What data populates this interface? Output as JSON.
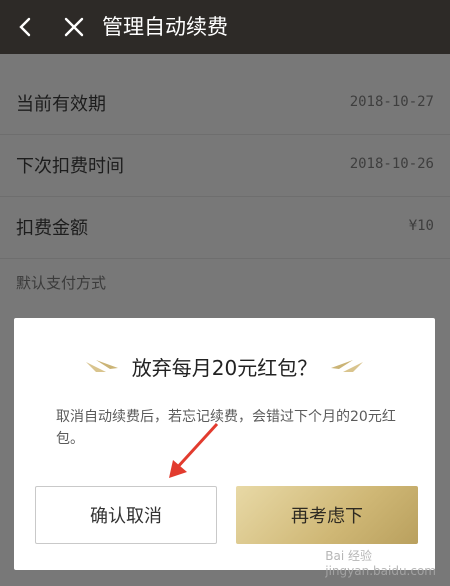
{
  "header": {
    "title": "管理自动续费",
    "back_icon": "chevron-left-icon",
    "close_icon": "close-icon"
  },
  "rows": [
    {
      "label": "当前有效期",
      "value": "2018-10-27"
    },
    {
      "label": "下次扣费时间",
      "value": "2018-10-26"
    },
    {
      "label": "扣费金额",
      "value": "¥10"
    }
  ],
  "section": {
    "payment_label": "默认支付方式"
  },
  "dialog": {
    "title": "放弃每月20元红包？",
    "description": "取消自动续费后，若忘记续费，会错过下个月的20元红包。",
    "confirm_label": "确认取消",
    "reconsider_label": "再考虑下"
  },
  "colors": {
    "header_bg": "#2d2a27",
    "gold_button": "#cfb775",
    "arrow": "#e23b2e"
  },
  "watermark": {
    "text": "Bai 经验",
    "subtext": "jingyan.baidu.com"
  }
}
